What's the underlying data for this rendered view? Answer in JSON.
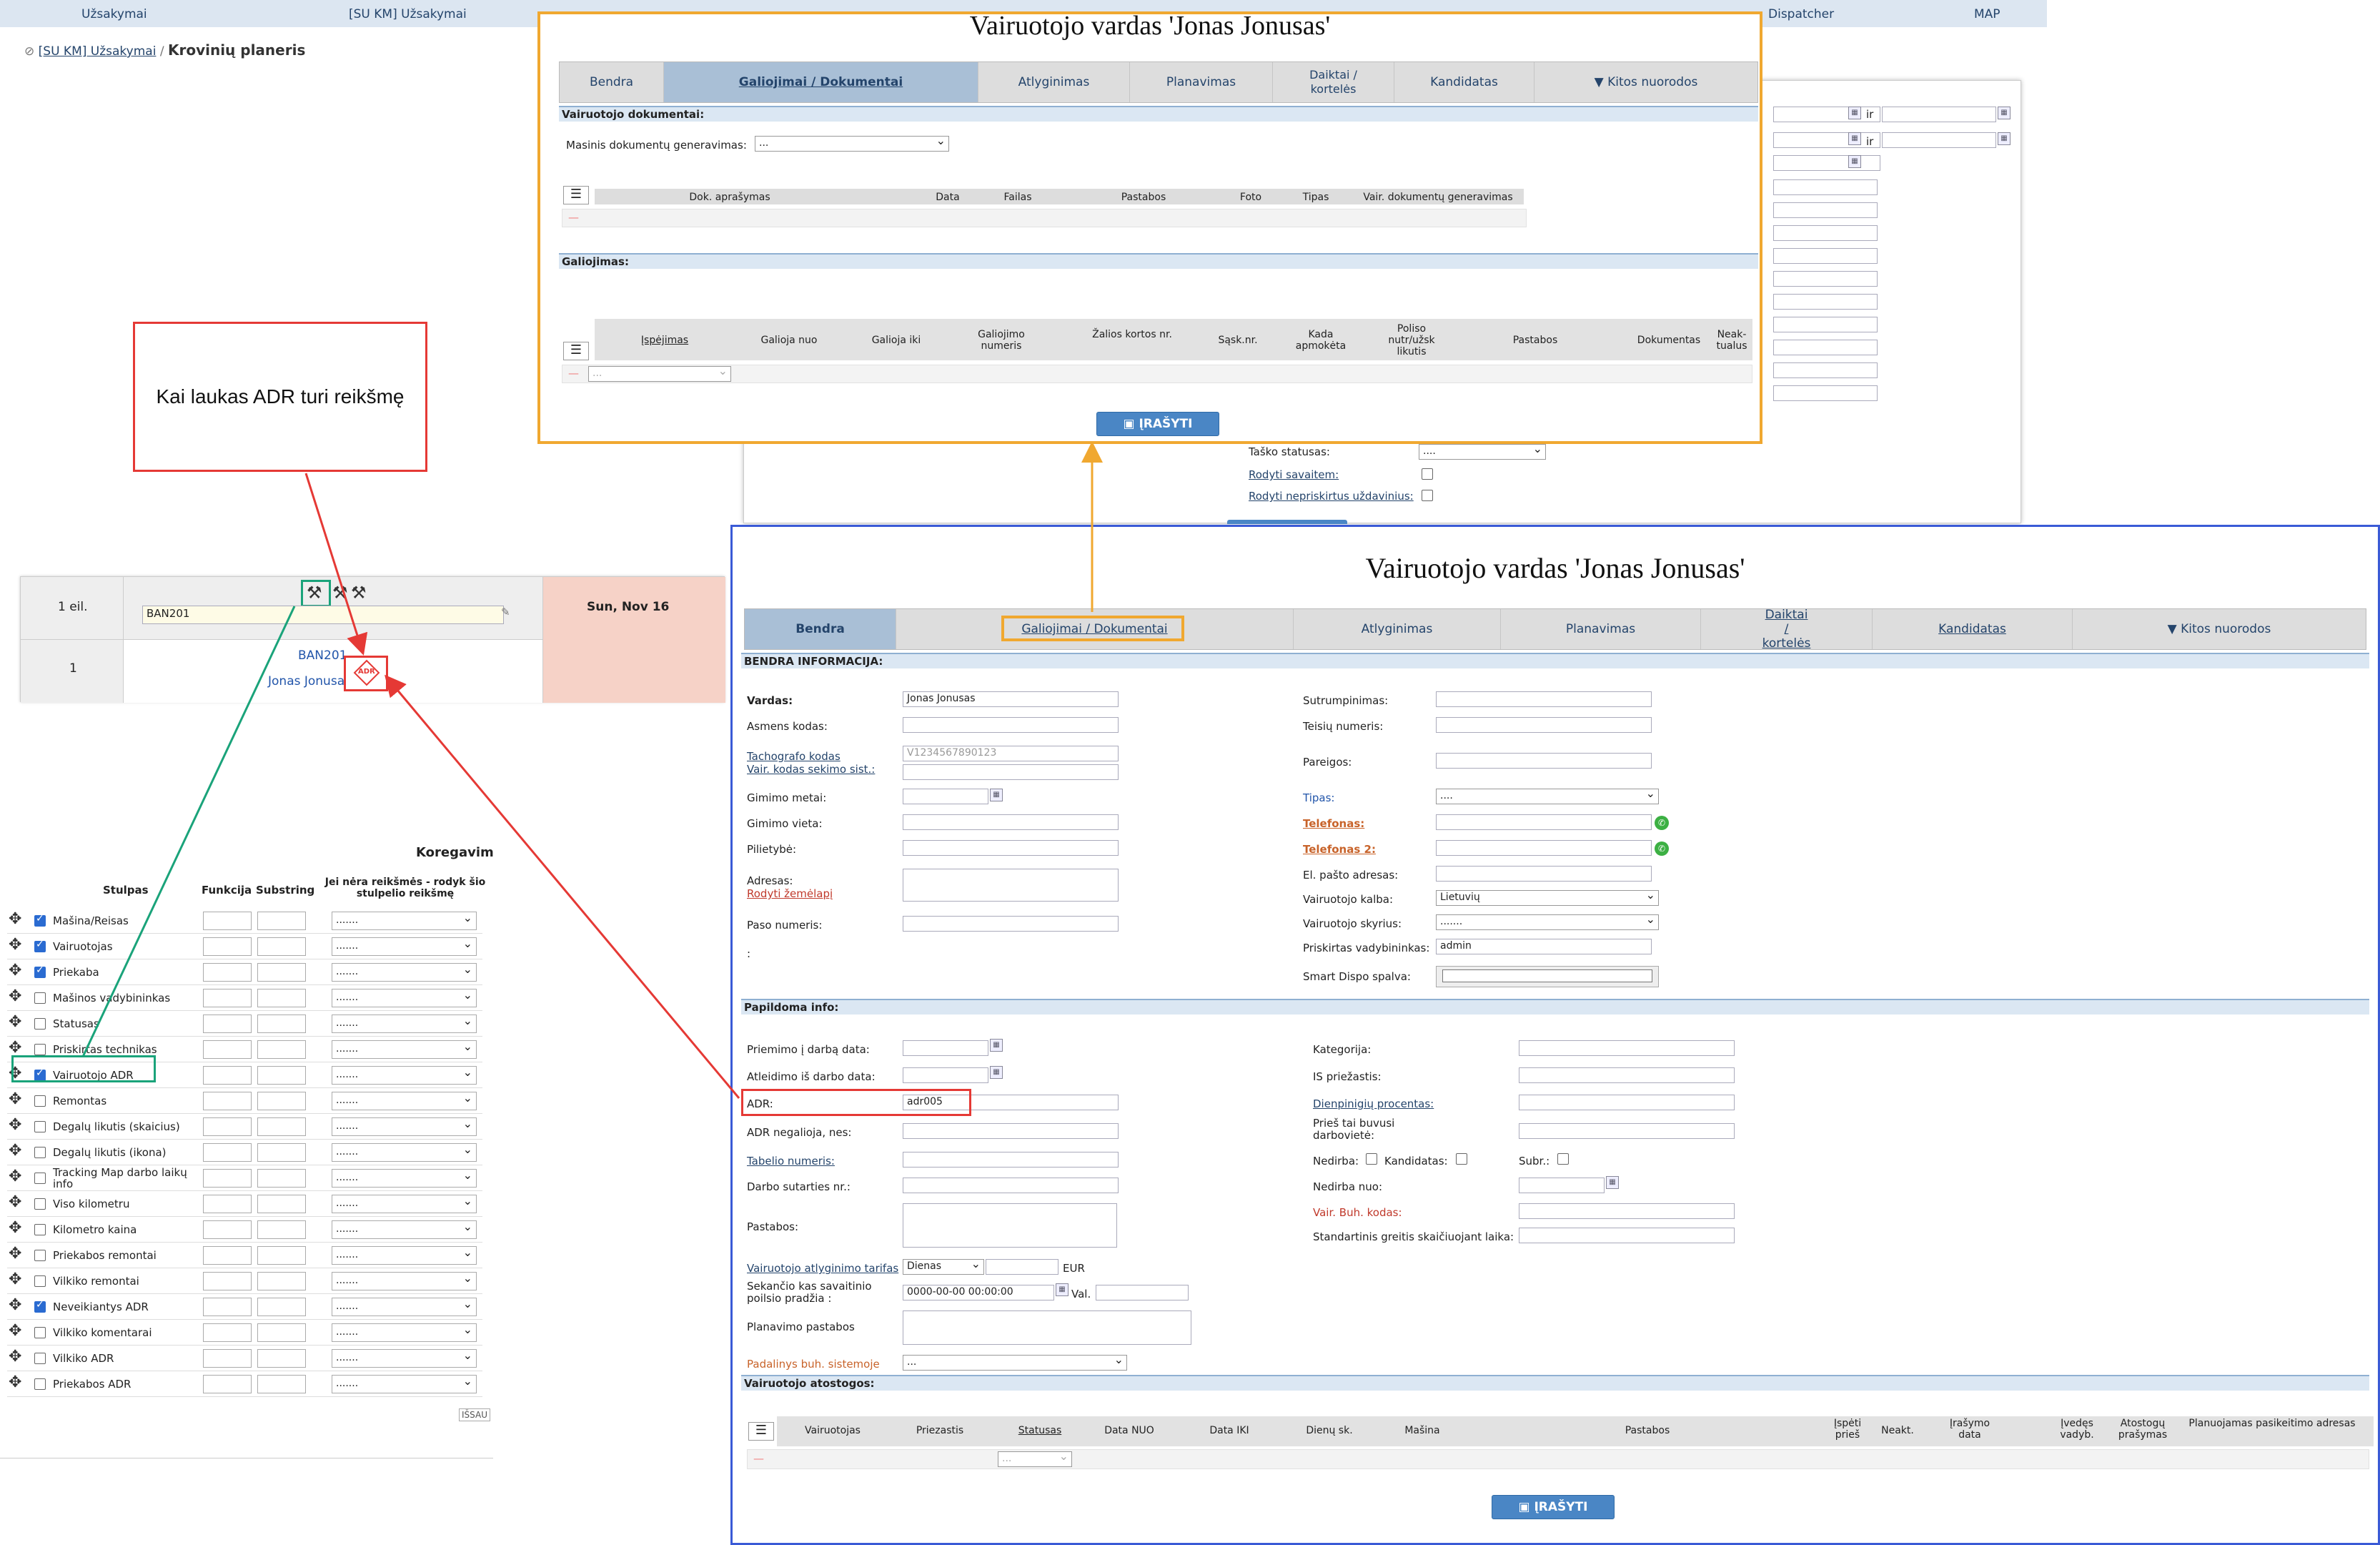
{
  "top_nav": {
    "uzsakymai": "Užsakymai",
    "su_km_uzsakymai": "[SU KM] Užsakymai",
    "dispatcher": "Dispatcher",
    "map": "MAP"
  },
  "breadcrumb": {
    "parent": "[SU KM] Užsakymai",
    "separator": "/",
    "current": "Krovinių planeris"
  },
  "callout": {
    "text": "Kai laukas ADR turi reikšmę"
  },
  "planner": {
    "row_label": "1 eil.",
    "row_input": "BAN201",
    "date_header": "Sun, Nov 16",
    "row_num": "1",
    "vehicle": "BAN201",
    "driver": "Jonas Jonusas",
    "adr_badge": "ADR"
  },
  "columns_config": {
    "title": "Koregavim",
    "headers": {
      "column": "Stulpas",
      "function": "Funkcija",
      "substring": "Substring",
      "if_empty": "Jei nėra reikšmės - rodyk šio stulpelio reikšmę"
    },
    "select_default": ".......",
    "rows": [
      {
        "label": "Mašina/Reisas",
        "checked": true
      },
      {
        "label": "Vairuotojas",
        "checked": true
      },
      {
        "label": "Priekaba",
        "checked": true
      },
      {
        "label": "Mašinos vadybininkas",
        "checked": false
      },
      {
        "label": "Statusas",
        "checked": false
      },
      {
        "label": "Priskirtas technikas",
        "checked": false
      },
      {
        "label": "Vairuotojo ADR",
        "checked": true
      },
      {
        "label": "Remontas",
        "checked": false
      },
      {
        "label": "Degalų likutis (skaicius)",
        "checked": false
      },
      {
        "label": "Degalų likutis (ikona)",
        "checked": false
      },
      {
        "label": "Tracking Map darbo laikų info",
        "checked": false
      },
      {
        "label": "Viso kilometru",
        "checked": false
      },
      {
        "label": "Kilometro kaina",
        "checked": false
      },
      {
        "label": "Priekabos remontai",
        "checked": false
      },
      {
        "label": "Vilkiko remontai",
        "checked": false
      },
      {
        "label": "Neveikiantys ADR",
        "checked": true
      },
      {
        "label": "Vilkiko komentarai",
        "checked": false
      },
      {
        "label": "Vilkiko ADR",
        "checked": false
      },
      {
        "label": "Priekabos ADR",
        "checked": false
      }
    ],
    "footer_btn": "IŠSAU"
  },
  "bg_form": {
    "ir1": "ir",
    "ir2": "ir",
    "tasko_statusas": "Taško statusas:",
    "tasko_statusas_value": "....",
    "rodyti_savaitem": "Rodyti savaitem:",
    "rodyti_nepriskirtus": "Rodyti nepriskirtus uždavinius:"
  },
  "tabs": [
    "Bendra",
    "Galiojimai / Dokumentai",
    "Atlyginimas",
    "Planavimas",
    "Daiktai / kortelės",
    "Kandidatas",
    "▼ Kitos nuorodos"
  ],
  "popup_docs": {
    "title": "Vairuotojo vardas 'Jonas Jonusas'",
    "section_docs": "Vairuotojo dokumentai:",
    "mass_gen_label": "Masinis dokumentų generavimas:",
    "mass_gen_value": "...",
    "docs_headers": [
      "Dok. aprašymas",
      "Data",
      "Failas",
      "Pastabos",
      "Foto",
      "Tipas",
      "Vair. dokumentų generavimas"
    ],
    "section_valid": "Galiojimas:",
    "valid_headers": [
      "Įspėjimas",
      "Galioja nuo",
      "Galioja iki",
      "Galiojimo numeris",
      "Žalios kortos nr.",
      "Sąsk.nr.",
      "Kada apmokėta",
      "Poliso nutr/užsk likutis",
      "Pastabos",
      "Dokumentas",
      "Neak-tualus"
    ],
    "valid_select": "...",
    "save": "ĮRAŠYTI"
  },
  "popup_main": {
    "title": "Vairuotojo vardas 'Jonas Jonusas'",
    "section_general": "BENDRA INFORMACIJA:",
    "vardas_label": "Vardas:",
    "vardas_value": "Jonas Jonusas",
    "asmens_kodas": "Asmens kodas:",
    "tachografo_kodas": "Tachografo kodas",
    "tachografo_placeholder": "V1234567890123",
    "vair_kodas_sekimo": "Vair. kodas sekimo sist.:",
    "gimimo_metai": "Gimimo metai:",
    "gimimo_vieta": "Gimimo vieta:",
    "pilietybe": "Pilietybė:",
    "adresas": "Adresas:",
    "rodyti_zemelapi": "Rodyti žemėlapį",
    "paso_numeris": "Paso numeris:",
    "colon": ":",
    "sutrumpinimas": "Sutrumpinimas:",
    "teisiu_numeris": "Teisių numeris:",
    "pareigos": "Pareigos:",
    "tipas": "Tipas:",
    "tipas_value": "....",
    "telefonas": "Telefonas:",
    "telefonas2": "Telefonas 2:",
    "el_pastas": "El. pašto adresas:",
    "vairuotojo_kalba": "Vairuotojo kalba:",
    "kalba_value": "Lietuvių",
    "vairuotojo_skyrius": "Vairuotojo skyrius:",
    "skyrius_value": ".......",
    "priskirtas_vadybininkas": "Priskirtas vadybininkas:",
    "vadybininkas_value": "admin",
    "smart_dispo": "Smart Dispo spalva:",
    "section_extra": "Papildoma info:",
    "priemimo_data": "Priemimo į darbą data:",
    "atleidimo_data": "Atleidimo iš darbo data:",
    "adr_label": "ADR:",
    "adr_value": "adr005",
    "adr_negalioja": "ADR negalioja, nes:",
    "tabelio_numeris": "Tabelio numeris:",
    "darbo_sutarties": "Darbo sutarties nr.:",
    "pastabos": "Pastabos:",
    "atlyginimo_tarifas": "Vairuotojo atlyginimo tarifas",
    "tarifas_value": "Dienas",
    "eur": "EUR",
    "sekancio_poilsio": "Sekančio kas savaitinio poilsio pradžia :",
    "poilsio_value": "0000-00-00 00:00:00",
    "val": "Val.",
    "planavimo_pastabos": "Planavimo pastabos",
    "padalinys": "Padalinys buh. sistemoje",
    "padalinys_value": "...",
    "kategorija": "Kategorija:",
    "is_priezastis": "IS priežastis:",
    "dienpinigiu": "Dienpinigių procentas:",
    "pries_tai": "Prieš tai buvusi darbovietė:",
    "nedirba": "Nedirba:",
    "kandidatas": "Kandidatas:",
    "subr": "Subr.:",
    "nedirba_nuo": "Nedirba nuo:",
    "vair_buh_kodas": "Vair. Buh. kodas:",
    "standartinis_greitis": "Standartinis greitis skaičiuojant laika:",
    "section_holidays": "Vairuotojo atostogos:",
    "holiday_headers": [
      "Vairuotojas",
      "Priezastis",
      "Statusas",
      "Data NUO",
      "Data IKI",
      "Dienų sk.",
      "Mašina",
      "Pastabos",
      "Įspėti prieš",
      "Neakt.",
      "Įrašymo data",
      "Įvedęs vadyb.",
      "Atostogų prašymas",
      "Planuojamas pasikeitimo adresas"
    ],
    "save": "ĮRAŠYTI"
  },
  "icons": {
    "calendar": "calendar-icon",
    "phone": "phone-icon",
    "menu": "menu-icon",
    "remove": "remove-icon",
    "save": "save-icon",
    "move": "move-icon",
    "tool": "tool-icon"
  },
  "colors": {
    "orange_frame": "#f0a830",
    "blue_frame": "#3a5ad6",
    "red_arrow": "#e53935",
    "green_arrow": "#1aa37a",
    "tab_active": "#a9bfd6",
    "section": "#dbe7f3",
    "save_button": "#4a86c5",
    "date_cell": "#f6d2c7"
  }
}
